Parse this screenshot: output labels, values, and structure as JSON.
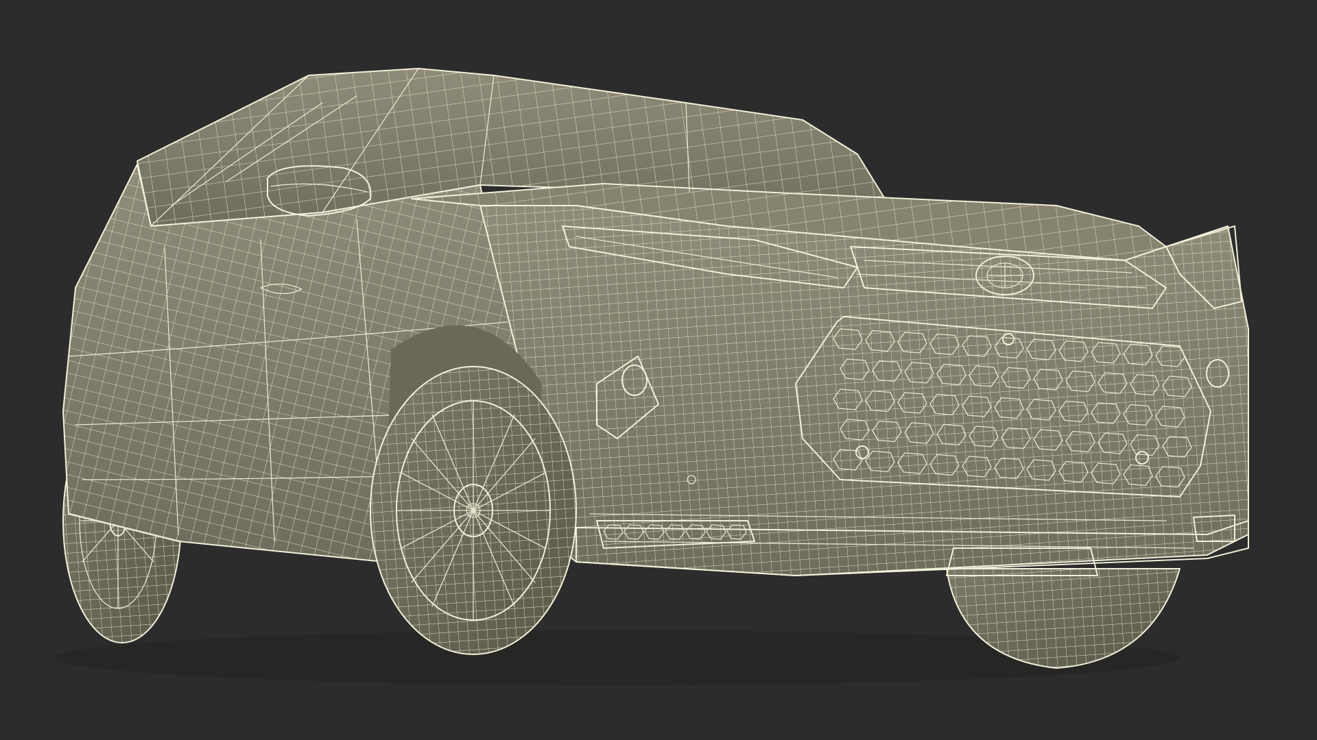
{
  "scene": {
    "subject": "",
    "background_color": "#2c2c2c",
    "body_color": "#84826f",
    "wire_color": "#e8e6cf",
    "shadow_color": "#3d3c34"
  }
}
